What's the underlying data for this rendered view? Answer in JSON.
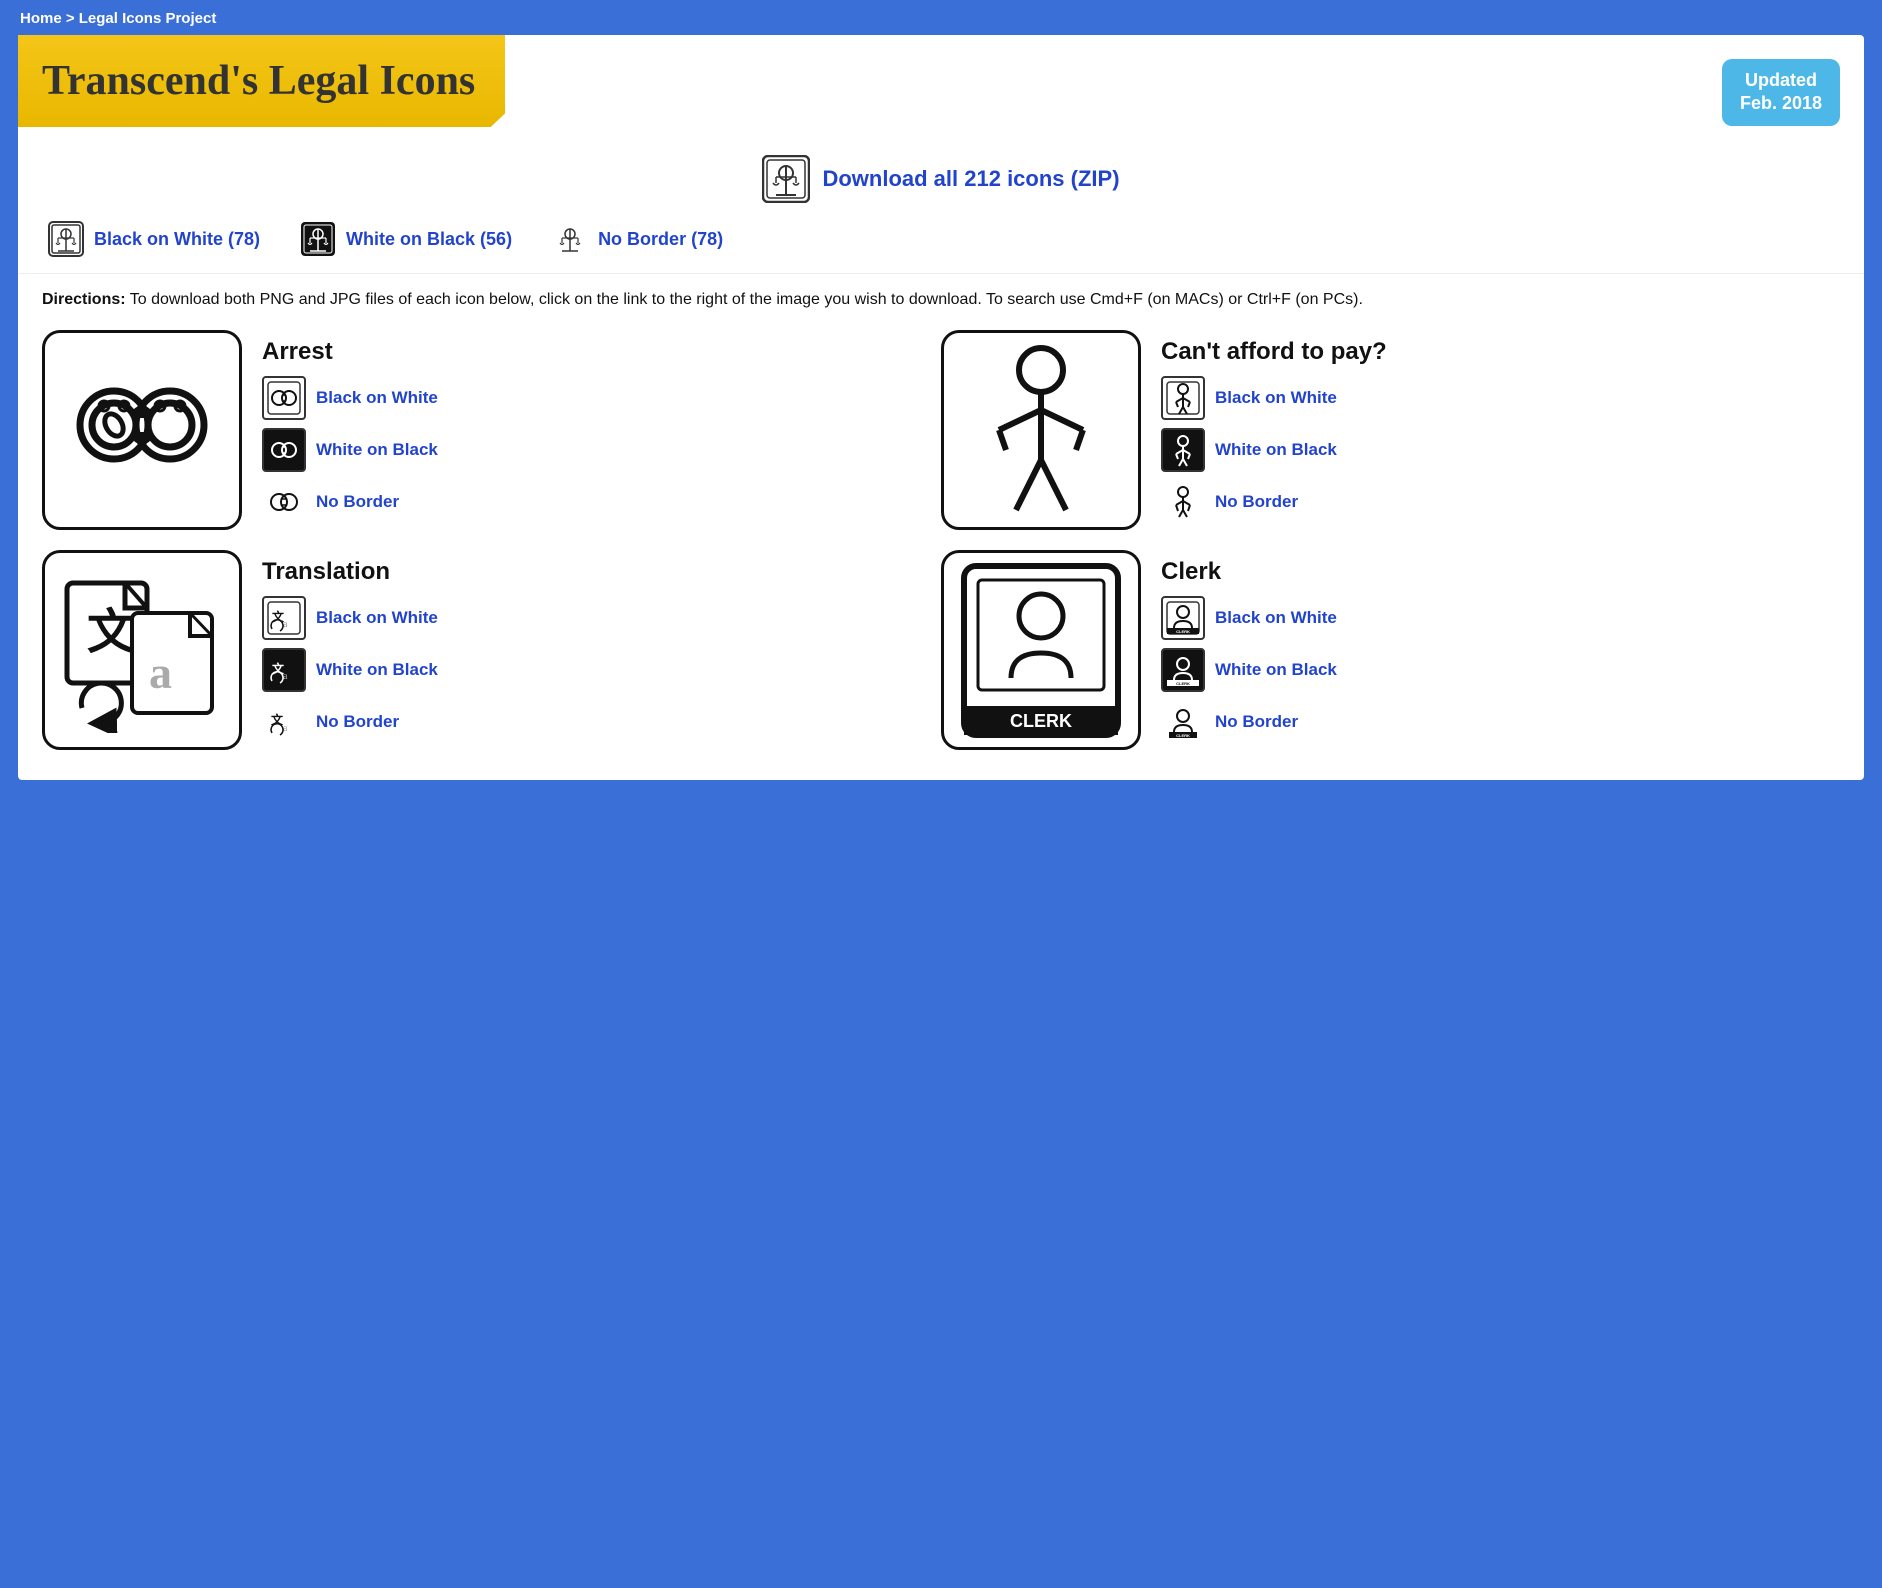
{
  "breadcrumb": "Home > Legal Icons Project",
  "header": {
    "title": "Transcend's Legal Icons",
    "updated_badge_line1": "Updated",
    "updated_badge_line2": "Feb. 2018"
  },
  "download": {
    "label": "Download all 212 icons (ZIP)"
  },
  "categories": [
    {
      "label": "Black on White (78)",
      "type": "bow"
    },
    {
      "label": "White on Black (56)",
      "type": "wob"
    },
    {
      "label": "No Border (78)",
      "type": "nb"
    }
  ],
  "directions": "To download both PNG and JPG files of each icon below, click on the link to the right of the image you wish to download. To search use Cmd+F (on MACs) or Ctrl+F (on PCs).",
  "icons": [
    {
      "name": "Arrest",
      "variants": [
        {
          "label": "Black on White",
          "type": "bow"
        },
        {
          "label": "White on Black",
          "type": "wob"
        },
        {
          "label": "No Border",
          "type": "nb"
        }
      ]
    },
    {
      "name": "Can't afford to pay?",
      "variants": [
        {
          "label": "Black on White",
          "type": "bow"
        },
        {
          "label": "White on Black",
          "type": "wob"
        },
        {
          "label": "No Border",
          "type": "nb"
        }
      ]
    },
    {
      "name": "Translation",
      "variants": [
        {
          "label": "Black on White",
          "type": "bow"
        },
        {
          "label": "White on Black",
          "type": "wob"
        },
        {
          "label": "No Border",
          "type": "nb"
        }
      ]
    },
    {
      "name": "Clerk",
      "variants": [
        {
          "label": "Black on White",
          "type": "bow"
        },
        {
          "label": "White on Black",
          "type": "wob"
        },
        {
          "label": "No Border",
          "type": "nb"
        }
      ]
    }
  ],
  "colors": {
    "blue_bg": "#3a6fd8",
    "yellow_banner": "#f5c518",
    "link_blue": "#2244cc",
    "badge_cyan": "#4db8e8"
  }
}
